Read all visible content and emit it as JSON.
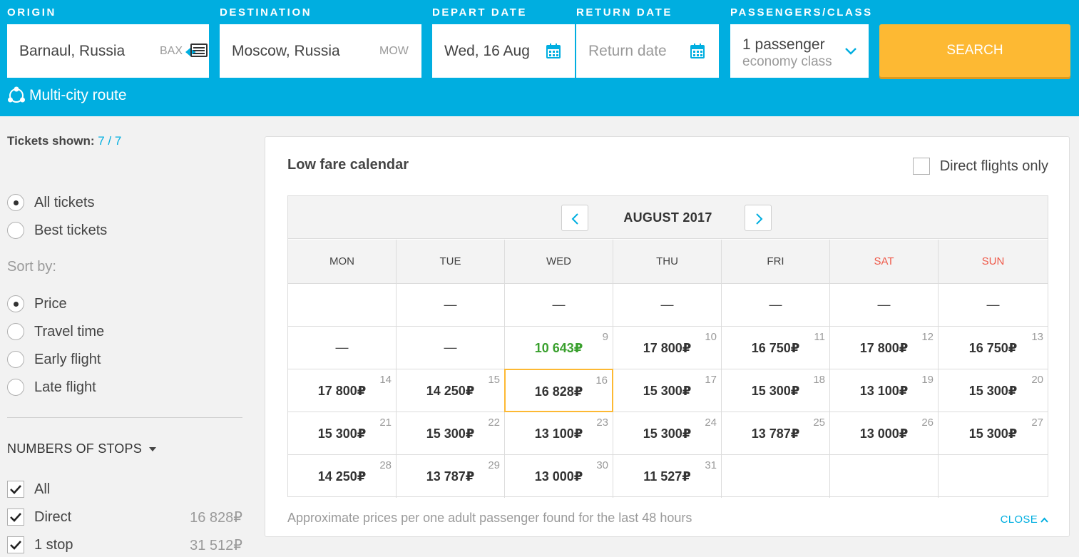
{
  "search": {
    "origin": {
      "label": "ORIGIN",
      "value": "Barnaul, Russia",
      "iata": "BAX"
    },
    "destination": {
      "label": "DESTINATION",
      "value": "Moscow, Russia",
      "iata": "MOW"
    },
    "depart": {
      "label": "DEPART DATE",
      "value": "Wed, 16 Aug"
    },
    "return_date": {
      "label": "RETURN DATE",
      "placeholder": "Return date"
    },
    "passengers": {
      "label": "PASSENGERS/CLASS",
      "count": "1 passenger",
      "class": "economy class"
    },
    "search_button": "SEARCH",
    "multicity": "Multi-city route",
    "colors": {
      "bar": "#00aee0",
      "button": "#fdb933"
    }
  },
  "sidebar": {
    "tickets_label": "Tickets shown:",
    "tickets_count": "7 / 7",
    "ticket_filters": [
      {
        "label": "All tickets",
        "checked": true
      },
      {
        "label": "Best tickets",
        "checked": false
      }
    ],
    "sort_title": "Sort by:",
    "sort_options": [
      {
        "label": "Price",
        "checked": true
      },
      {
        "label": "Travel time",
        "checked": false
      },
      {
        "label": "Early flight",
        "checked": false
      },
      {
        "label": "Late flight",
        "checked": false
      }
    ],
    "stops_title": "NUMBERS OF STOPS",
    "stops": [
      {
        "label": "All",
        "price": "",
        "checked": true
      },
      {
        "label": "Direct",
        "price": "16 828₽",
        "checked": true
      },
      {
        "label": "1 stop",
        "price": "31 512₽",
        "checked": true
      }
    ]
  },
  "calendar": {
    "title": "Low fare calendar",
    "direct_only": "Direct flights only",
    "month": "AUGUST 2017",
    "weekdays": [
      "MON",
      "TUE",
      "WED",
      "THU",
      "FRI",
      "SAT",
      "SUN"
    ],
    "weekend_color": "#ef5a4a",
    "best_color": "#3aa02e",
    "weeks": [
      [
        {
          "day": "",
          "price": "",
          "dash": ""
        },
        {
          "day": "",
          "price": "",
          "dash": "—"
        },
        {
          "day": "",
          "price": "",
          "dash": "—"
        },
        {
          "day": "",
          "price": "",
          "dash": "—"
        },
        {
          "day": "",
          "price": "",
          "dash": "—"
        },
        {
          "day": "",
          "price": "",
          "dash": "—"
        },
        {
          "day": "",
          "price": "",
          "dash": "—"
        }
      ],
      [
        {
          "day": "",
          "price": "",
          "dash": "—"
        },
        {
          "day": "",
          "price": "",
          "dash": "—"
        },
        {
          "day": "9",
          "price": "10 643₽",
          "best": true
        },
        {
          "day": "10",
          "price": "17 800₽"
        },
        {
          "day": "11",
          "price": "16 750₽"
        },
        {
          "day": "12",
          "price": "17 800₽"
        },
        {
          "day": "13",
          "price": "16 750₽"
        }
      ],
      [
        {
          "day": "14",
          "price": "17 800₽"
        },
        {
          "day": "15",
          "price": "14 250₽"
        },
        {
          "day": "16",
          "price": "16 828₽",
          "selected": true
        },
        {
          "day": "17",
          "price": "15 300₽"
        },
        {
          "day": "18",
          "price": "15 300₽"
        },
        {
          "day": "19",
          "price": "13 100₽"
        },
        {
          "day": "20",
          "price": "15 300₽"
        }
      ],
      [
        {
          "day": "21",
          "price": "15 300₽"
        },
        {
          "day": "22",
          "price": "15 300₽"
        },
        {
          "day": "23",
          "price": "13 100₽"
        },
        {
          "day": "24",
          "price": "15 300₽"
        },
        {
          "day": "25",
          "price": "13 787₽"
        },
        {
          "day": "26",
          "price": "13 000₽"
        },
        {
          "day": "27",
          "price": "15 300₽"
        }
      ],
      [
        {
          "day": "28",
          "price": "14 250₽"
        },
        {
          "day": "29",
          "price": "13 787₽"
        },
        {
          "day": "30",
          "price": "13 000₽"
        },
        {
          "day": "31",
          "price": "11 527₽"
        },
        {
          "day": "",
          "price": ""
        },
        {
          "day": "",
          "price": ""
        },
        {
          "day": "",
          "price": ""
        }
      ]
    ],
    "footnote": "Approximate prices per one adult passenger found for the last 48 hours",
    "close_label": "CLOSE"
  }
}
